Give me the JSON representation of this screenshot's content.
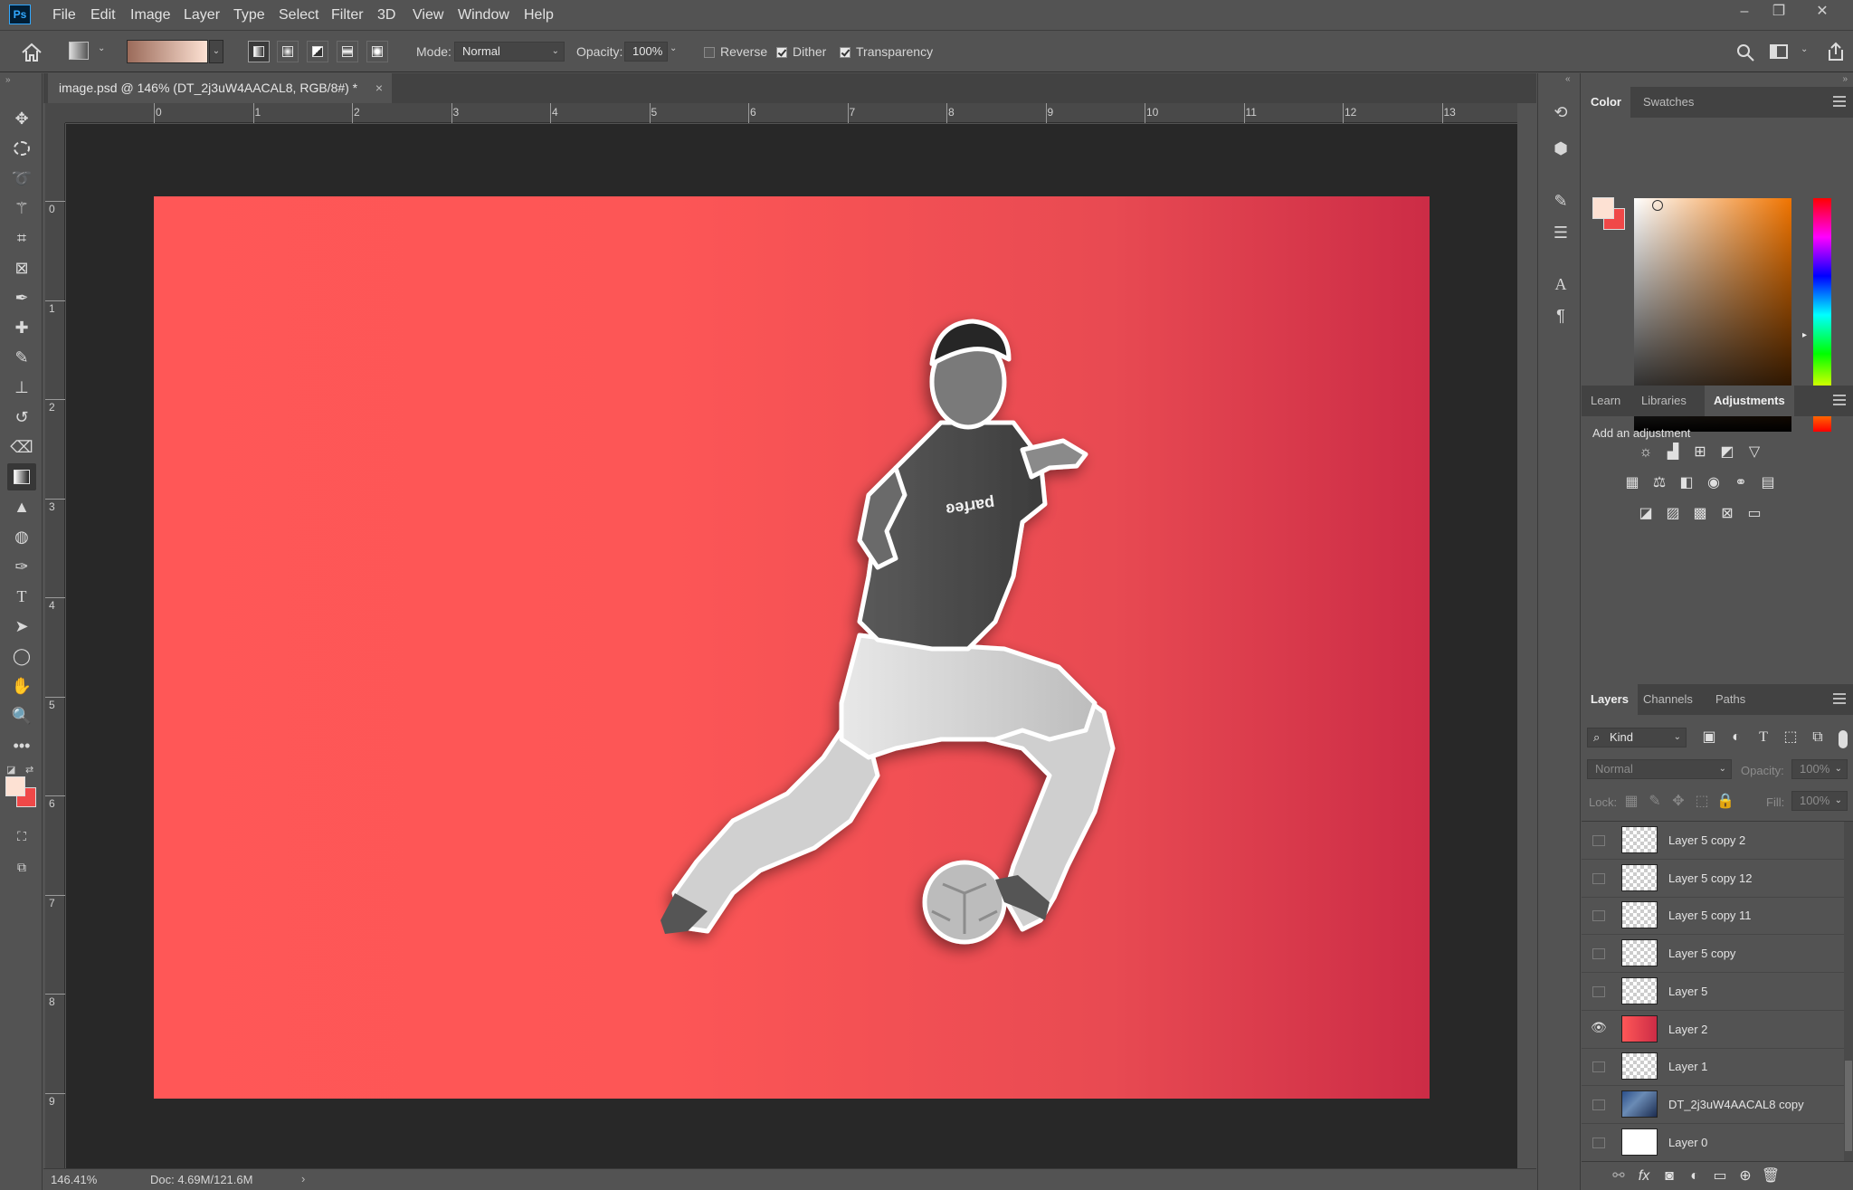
{
  "app": {
    "logo": "Ps"
  },
  "menu": [
    "File",
    "Edit",
    "Image",
    "Layer",
    "Type",
    "Select",
    "Filter",
    "3D",
    "View",
    "Window",
    "Help"
  ],
  "window_controls": {
    "minimize": "–",
    "restore": "❐",
    "close": "✕"
  },
  "options": {
    "mode_label": "Mode:",
    "mode_value": "Normal",
    "opacity_label": "Opacity:",
    "opacity_value": "100%",
    "reverse_label": "Reverse",
    "dither_label": "Dither",
    "transparency_label": "Transparency",
    "reverse_checked": false,
    "dither_checked": true,
    "transparency_checked": true
  },
  "document": {
    "tab_title": "image.psd @ 146% (DT_2j3uW4AACAL8, RGB/8#) *",
    "close": "×",
    "ruler_h": [
      "0",
      "1",
      "2",
      "3",
      "4",
      "5",
      "6",
      "7",
      "8",
      "9",
      "10",
      "11",
      "12",
      "13"
    ],
    "ruler_v": [
      "0",
      "1",
      "2",
      "3",
      "4",
      "5",
      "6",
      "7",
      "8",
      "9"
    ]
  },
  "status": {
    "zoom": "146.41%",
    "doc": "Doc: 4.69M/121.6M",
    "arrow": "›"
  },
  "colors": {
    "foreground": "#fde1d3",
    "background": "#f04848",
    "canvas_start": "#ff5757",
    "canvas_end": "#cc2c46"
  },
  "color_panel": {
    "tabs": [
      "Color",
      "Swatches"
    ],
    "active": "Color"
  },
  "adjustments_panel": {
    "tabs": [
      "Learn",
      "Libraries",
      "Adjustments"
    ],
    "active": "Adjustments",
    "hint": "Add an adjustment"
  },
  "layers_panel": {
    "tabs": [
      "Layers",
      "Channels",
      "Paths"
    ],
    "active": "Layers",
    "filter_kind": "Kind",
    "blend_mode": "Normal",
    "opacity_label": "Opacity:",
    "opacity_value": "100%",
    "lock_label": "Lock:",
    "fill_label": "Fill:",
    "fill_value": "100%",
    "layers": [
      {
        "name": "Layer 5 copy 2",
        "visible": false
      },
      {
        "name": "Layer 5 copy 12",
        "visible": false
      },
      {
        "name": "Layer 5 copy 11",
        "visible": false
      },
      {
        "name": "Layer 5 copy",
        "visible": false
      },
      {
        "name": "Layer 5",
        "visible": false
      },
      {
        "name": "Layer 2",
        "visible": true
      },
      {
        "name": "Layer 1",
        "visible": false
      },
      {
        "name": "DT_2j3uW4AACAL8 copy",
        "visible": false
      },
      {
        "name": "Layer 0",
        "visible": false
      }
    ],
    "footer_fx": "fx"
  }
}
